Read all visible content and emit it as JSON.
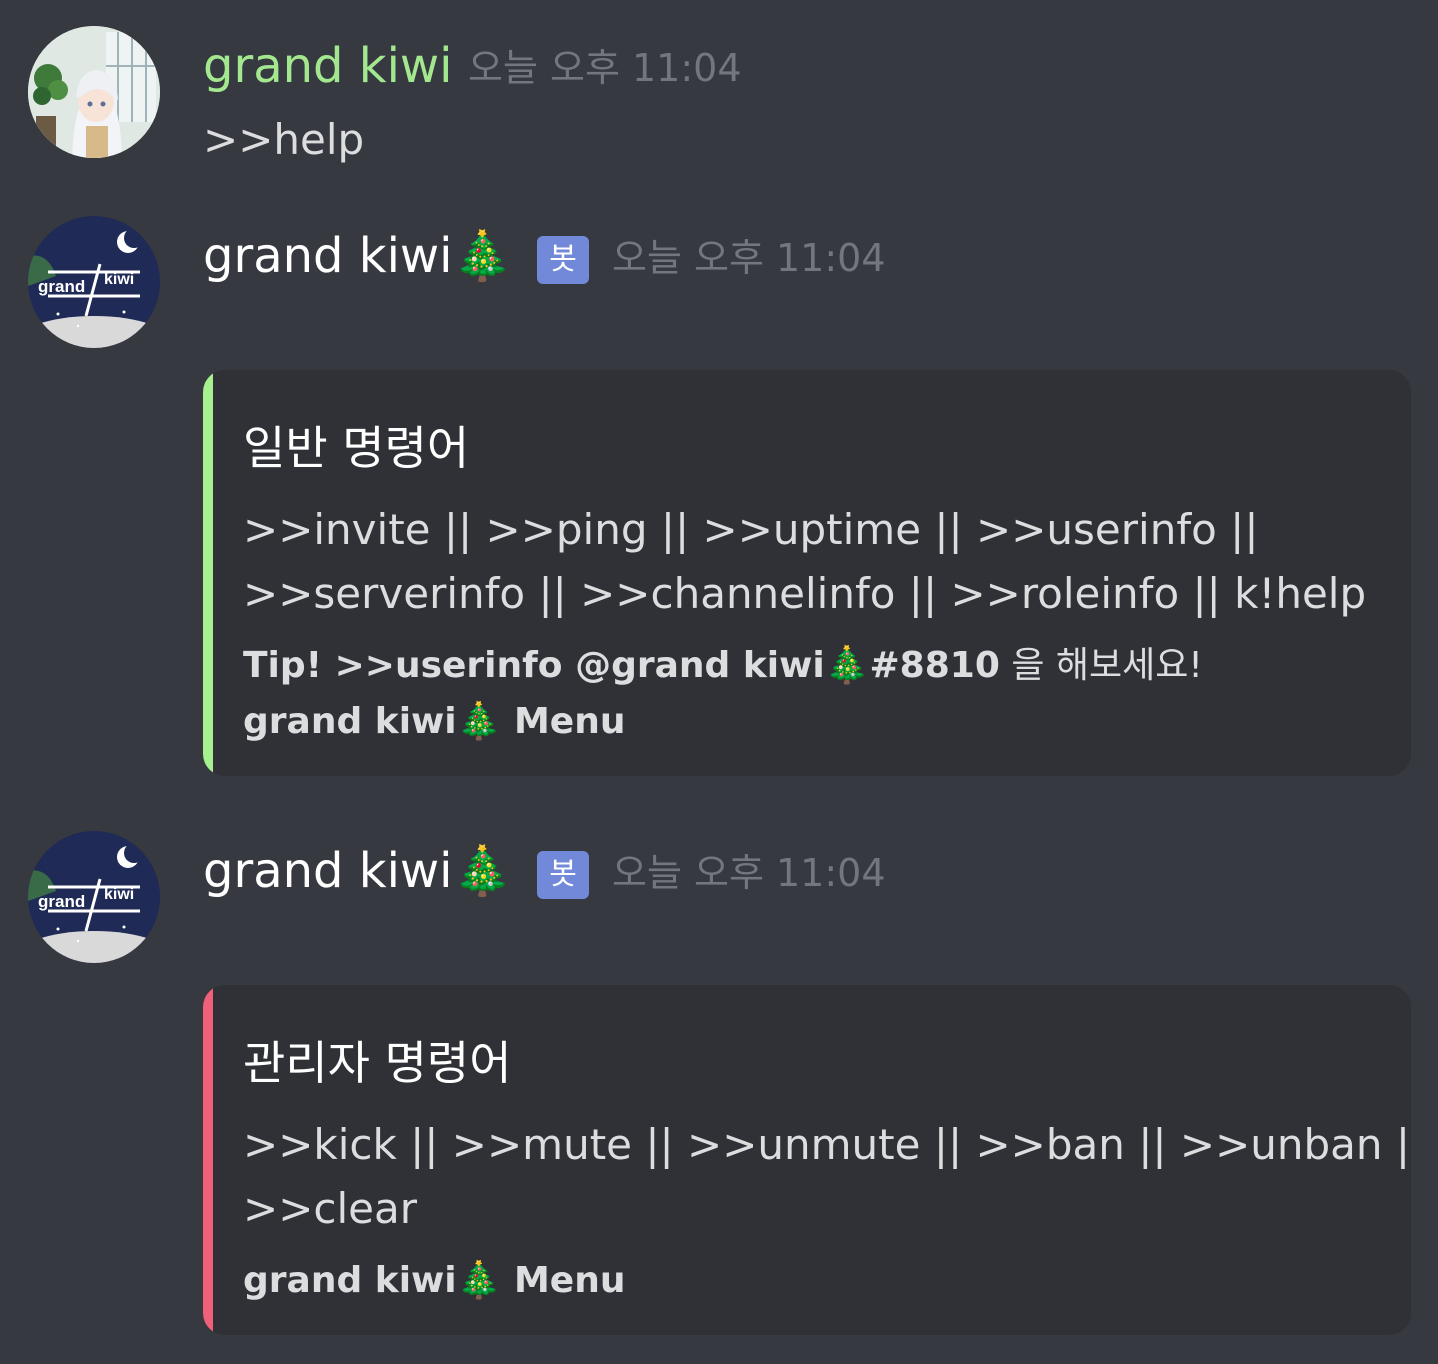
{
  "colors": {
    "background": "#36393f",
    "embed_background": "#2f3136",
    "user_name_green": "#a3e88f",
    "bot_tag": "#7289da",
    "embed_bar_green": "#a6f090",
    "embed_bar_red": "#f0607a",
    "timestamp": "#72767d"
  },
  "messages": [
    {
      "username": "grand kiwi",
      "timestamp": "오늘 오후 11:04",
      "content": ">>help",
      "avatar_icon": "anime-girl-avatar"
    },
    {
      "username": "grand kiwi🎄",
      "bot_tag": "봇",
      "timestamp": "오늘 오후 11:04",
      "avatar_icon": "grand-kiwi-bot-avatar",
      "avatar_text_1": "grand",
      "avatar_text_2": "kiwi",
      "embed": {
        "title": "일반 명령어",
        "line1": ">>invite || >>ping || >>uptime || >>userinfo ||",
        "line2": ">>serverinfo || >>channelinfo || >>roleinfo || k!help",
        "tip_bold": "Tip! >>userinfo @grand kiwi🎄#8810",
        "tip_rest": " 을 해보세요!",
        "footer": "grand kiwi🎄 Menu"
      }
    },
    {
      "username": "grand kiwi🎄",
      "bot_tag": "봇",
      "timestamp": "오늘 오후 11:04",
      "avatar_icon": "grand-kiwi-bot-avatar",
      "avatar_text_1": "grand",
      "avatar_text_2": "kiwi",
      "embed": {
        "title": "관리자 명령어",
        "line1": ">>kick || >>mute || >>unmute || >>ban || >>unban ||",
        "line2": ">>clear",
        "footer": "grand kiwi🎄 Menu"
      }
    }
  ]
}
